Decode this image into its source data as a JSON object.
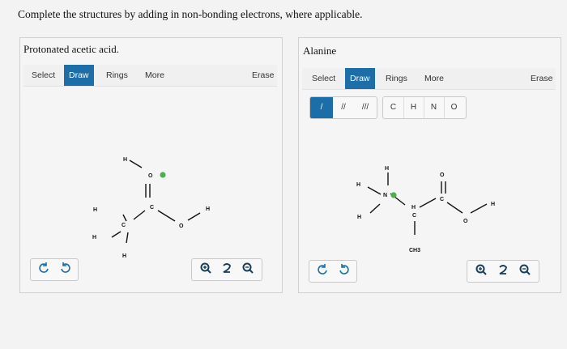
{
  "question": "Complete the structures by adding in non-bonding electrons, where applicable.",
  "left_panel": {
    "title": "Protonated acetic acid.",
    "toolbar": {
      "select": "Select",
      "draw": "Draw",
      "rings": "Rings",
      "more": "More",
      "erase": "Erase"
    },
    "atoms": {
      "o_top": "O",
      "c_carbonyl": "C",
      "o_ether": "O",
      "h_right": "H",
      "c_methyl": "C",
      "h_top_left": "H",
      "h_left1": "H",
      "h_left2": "H",
      "h_bottom": "H"
    }
  },
  "right_panel": {
    "title": "Alanine",
    "toolbar": {
      "select": "Select",
      "draw": "Draw",
      "rings": "Rings",
      "more": "More",
      "erase": "Erase"
    },
    "bond_tools": [
      "/",
      "//",
      "///"
    ],
    "elements": [
      "C",
      "H",
      "N",
      "O"
    ],
    "atoms": {
      "h_top": "H",
      "h_left": "H",
      "n": "N",
      "h_lower_left": "H",
      "c_alpha": "C",
      "h_alpha": "H",
      "ch3": "CH3",
      "c_carbonyl": "C",
      "o_top": "O",
      "o_ether": "O",
      "h_right": "H"
    }
  },
  "accent_color": "#1c6ea8",
  "radical_dot_color": "#4caf50"
}
